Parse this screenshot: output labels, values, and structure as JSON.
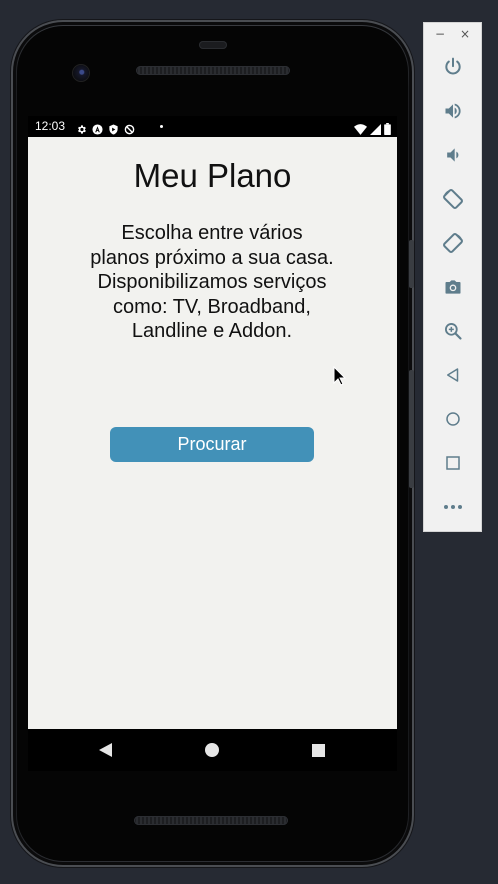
{
  "status_bar": {
    "time": "12:03"
  },
  "app": {
    "title": "Meu Plano",
    "description_lines": [
      "Escolha entre vários",
      "planos próximo a sua casa.",
      "Disponibilizamos serviços",
      "como: TV, Broadband,",
      "Landline e Addon."
    ],
    "search_button_label": "Procurar"
  },
  "emulator_toolbar": {
    "minimize": "−",
    "close": "×",
    "buttons": [
      {
        "icon": "power-icon"
      },
      {
        "icon": "volume-up-icon"
      },
      {
        "icon": "volume-down-icon"
      },
      {
        "icon": "rotate-left-icon"
      },
      {
        "icon": "rotate-right-icon"
      },
      {
        "icon": "camera-icon"
      },
      {
        "icon": "zoom-icon"
      },
      {
        "icon": "back-icon"
      },
      {
        "icon": "home-icon"
      },
      {
        "icon": "overview-icon"
      },
      {
        "icon": "more-icon"
      }
    ]
  },
  "colors": {
    "screen_background": "#f2f2ef",
    "button_background": "#4291b8",
    "button_text": "#ffffff",
    "toolbar_icon": "#5f7d8c"
  }
}
